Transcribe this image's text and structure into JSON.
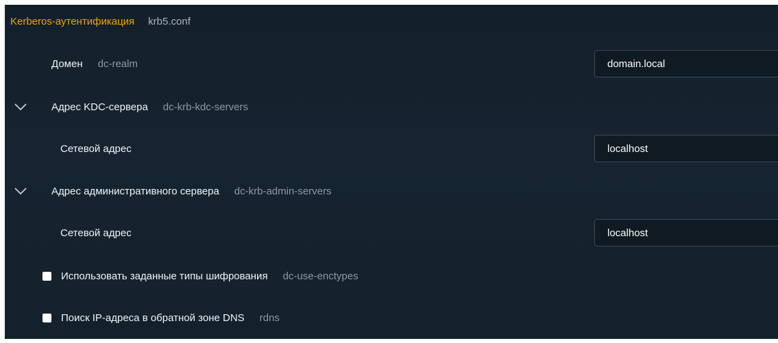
{
  "section": {
    "title": "Kerberos-аутентификация",
    "file": "krb5.conf",
    "title_color": "#f0a500"
  },
  "domain": {
    "label": "Домен",
    "key": "dc-realm",
    "value": "domain.local"
  },
  "kdc": {
    "label": "Адрес KDC-сервера",
    "key": "dc-krb-kdc-servers",
    "icon": "chevron-down-icon",
    "address_label": "Сетевой адрес",
    "address_value": "localhost"
  },
  "admin": {
    "label": "Адрес административного сервера",
    "key": "dc-krb-admin-servers",
    "icon": "chevron-down-icon",
    "address_label": "Сетевой адрес",
    "address_value": "localhost"
  },
  "enctypes": {
    "label": "Использовать заданные типы шифрования",
    "key": "dc-use-enctypes",
    "checked": false
  },
  "rdns": {
    "label": "Поиск IP-адреса в обратной зоне DNS",
    "key": "rdns",
    "checked": false
  }
}
